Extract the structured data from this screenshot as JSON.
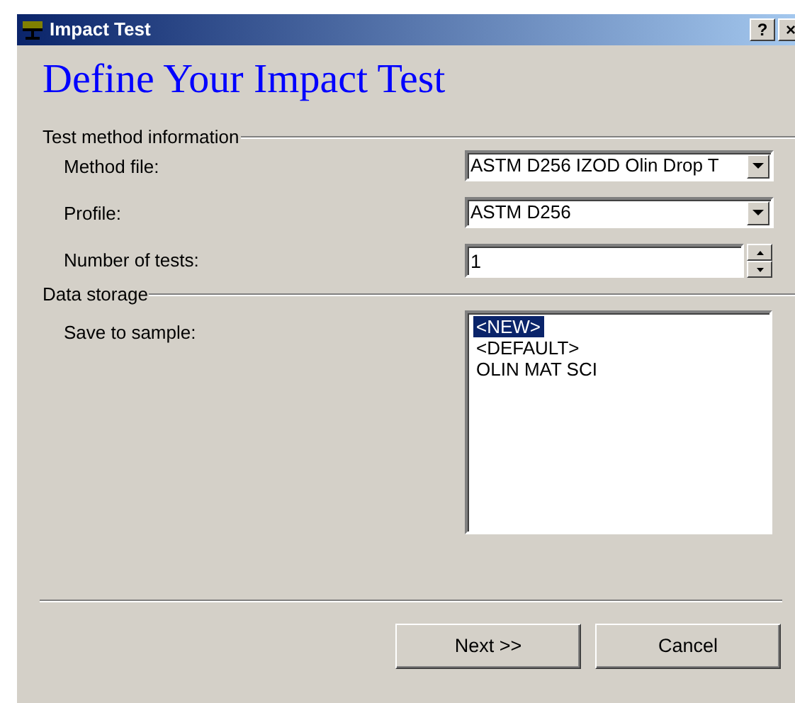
{
  "window": {
    "title": "Impact Test",
    "buttons": [
      "?",
      "×"
    ]
  },
  "heading": "Define Your Impact Test",
  "groups": [
    {
      "title": "Test method information",
      "fields": [
        {
          "kind": "dropdown",
          "label": "Method file:",
          "value": "ASTM D256 IZOD Olin Drop T"
        },
        {
          "kind": "dropdown",
          "label": "Profile:",
          "value": "ASTM D256"
        },
        {
          "kind": "spinner",
          "label": "Number of tests:",
          "value": "1"
        }
      ]
    },
    {
      "title": "Data storage",
      "fields": [
        {
          "kind": "listbox",
          "label": "Save to sample:",
          "items": [
            {
              "label": "<NEW>",
              "selected": true
            },
            {
              "label": "<DEFAULT>",
              "selected": false
            },
            {
              "label": "OLIN MAT SCI",
              "selected": false
            }
          ]
        }
      ]
    }
  ],
  "buttons": [
    "Next >>",
    "Cancel"
  ]
}
